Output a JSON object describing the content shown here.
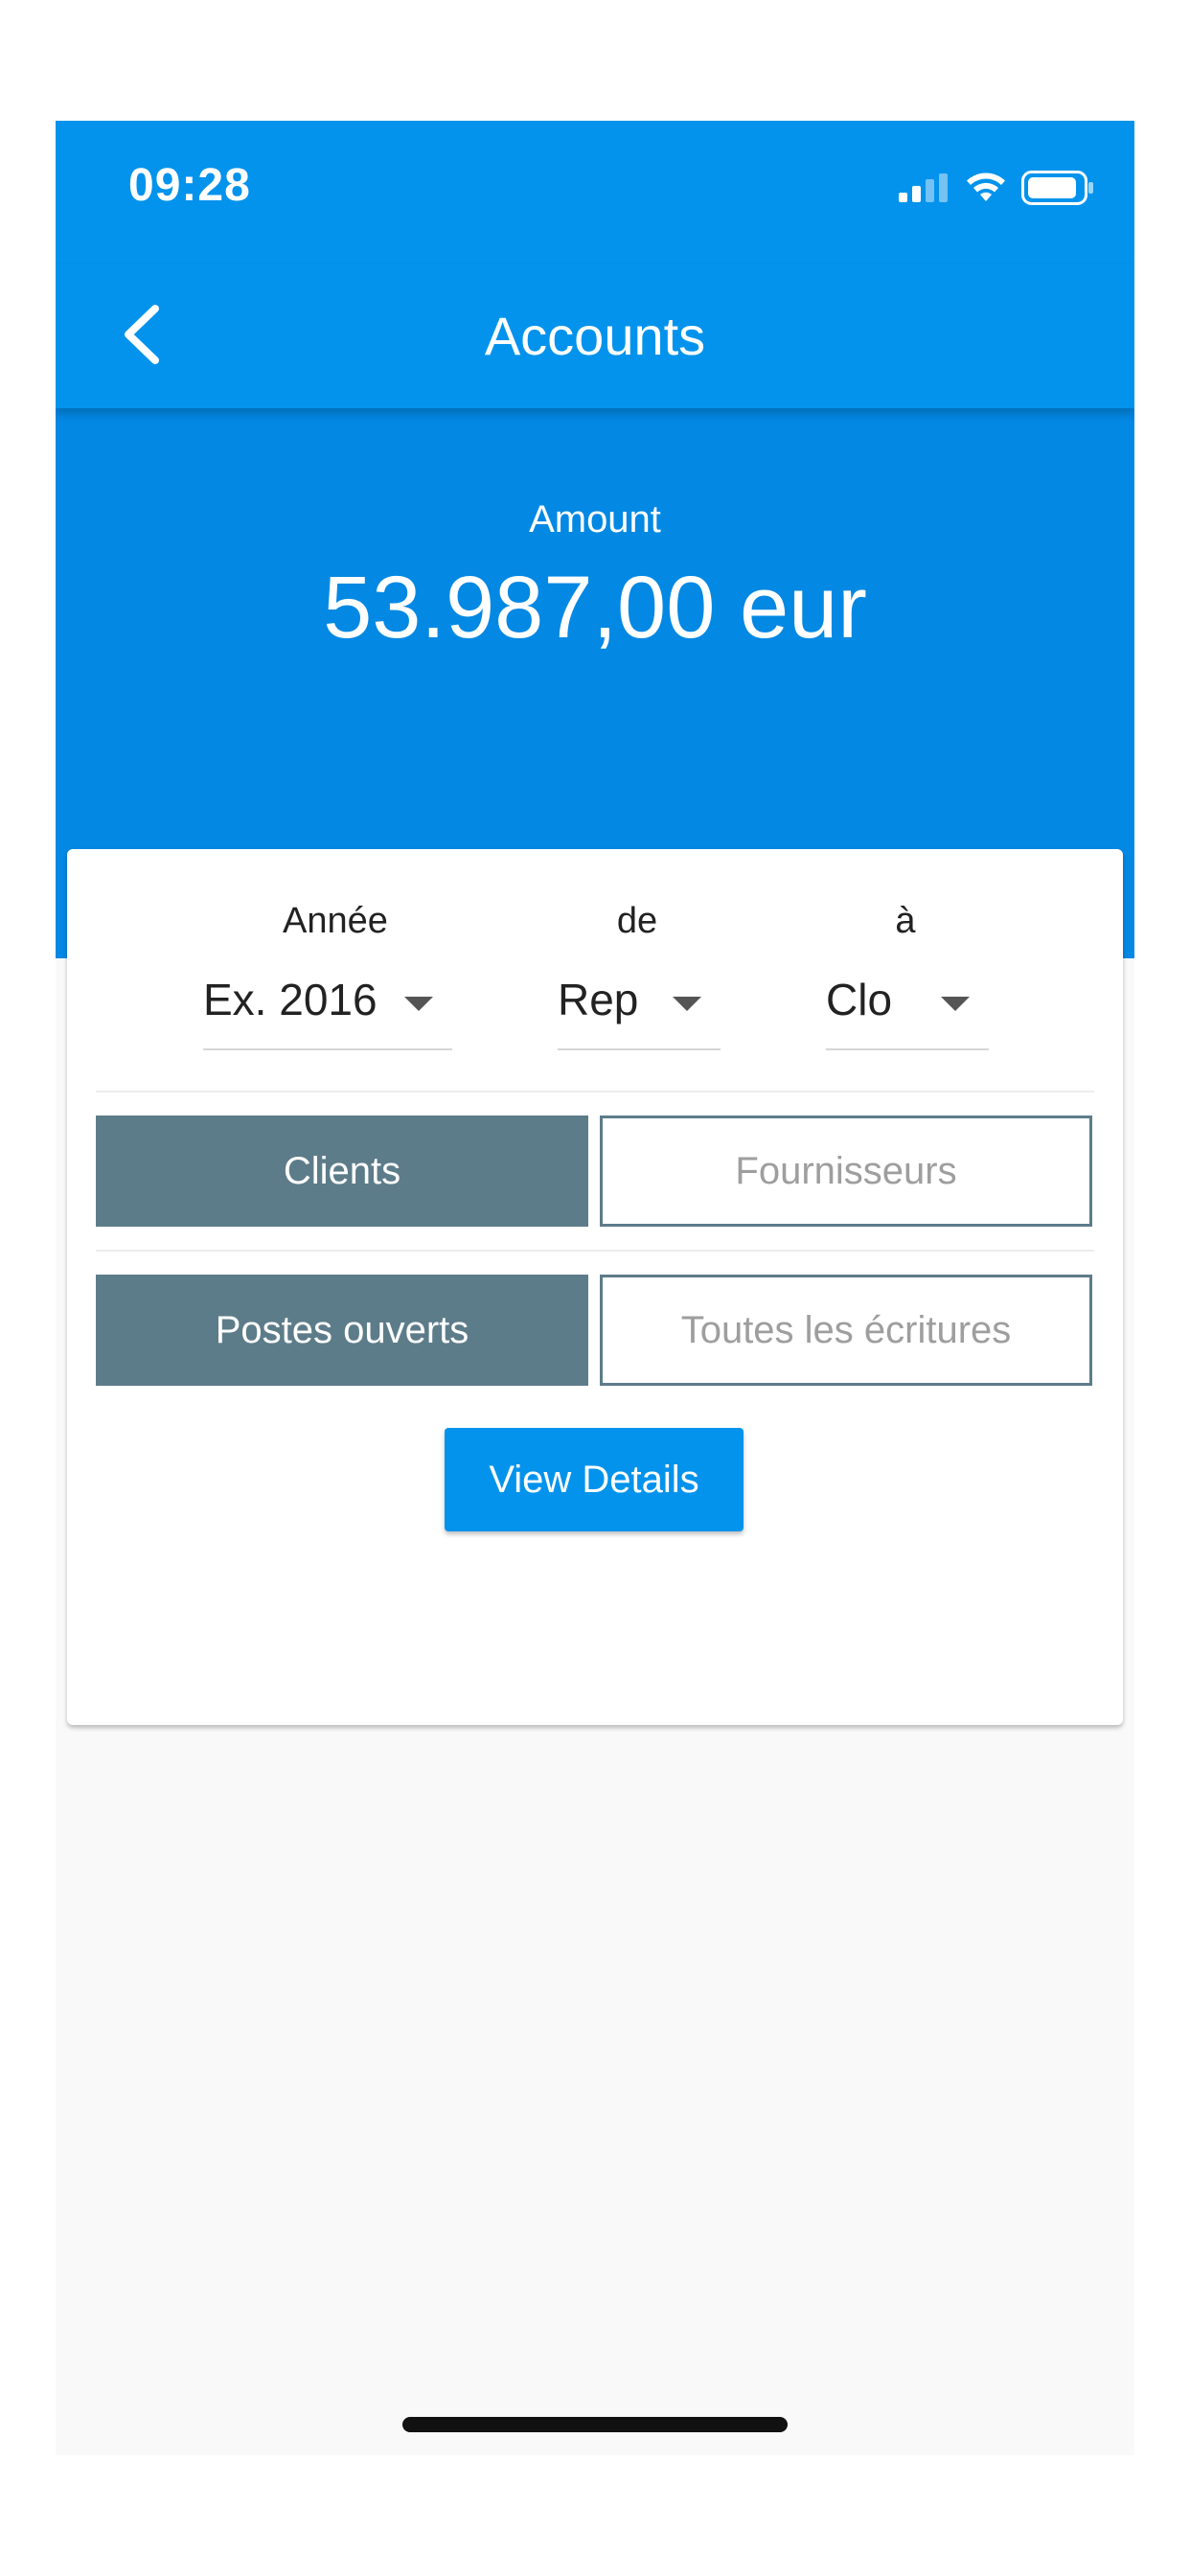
{
  "status_bar": {
    "time": "09:28"
  },
  "nav": {
    "title": "Accounts"
  },
  "summary": {
    "label": "Amount",
    "value": "53.987,00 eur"
  },
  "filters": {
    "year": {
      "label": "Année",
      "value": "Ex. 2016"
    },
    "from": {
      "label": "de",
      "value": "Rep"
    },
    "to": {
      "label": "à",
      "value": "Clo"
    }
  },
  "party_toggle": {
    "options": [
      "Clients",
      "Fournisseurs"
    ],
    "selected": "Clients"
  },
  "entries_toggle": {
    "options": [
      "Postes ouverts",
      "Toutes les écritures"
    ],
    "selected": "Postes ouverts"
  },
  "actions": {
    "view_details": "View Details"
  },
  "colors": {
    "primary": "#0393ec",
    "header_dark": "#0388e3",
    "segment_active": "#5d7c8a",
    "page_background": "#f9f9f9"
  },
  "icons": [
    "back-chevron-icon",
    "cellular-signal-icon",
    "wifi-icon",
    "battery-icon",
    "dropdown-caret-icon"
  ]
}
